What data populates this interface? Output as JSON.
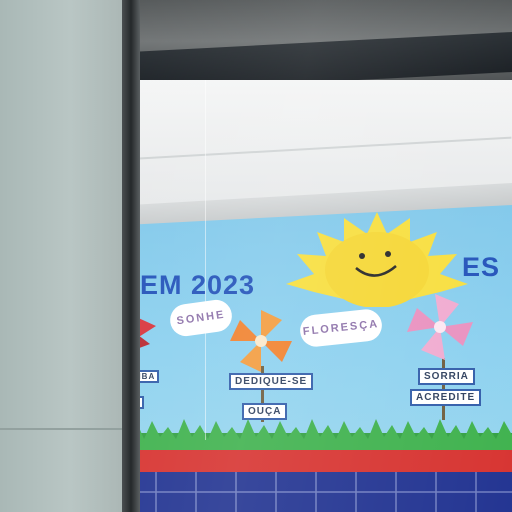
{
  "board": {
    "title_left": "EM 2023",
    "title_right": "ES",
    "clouds": {
      "sonhe": "SONHE",
      "floresca": "FLORESÇA"
    },
    "tags": {
      "dedique": "DEDIQUE-SE",
      "ouca": "OUÇA",
      "sorria": "SORRIA",
      "acredite": "ACREDITE",
      "frag1": "MBA",
      "frag2": "E"
    }
  },
  "colors": {
    "title": "#1e4fb8",
    "board_bg": "#8ad0ef",
    "sun": "#f7de3a",
    "red_band": "#d62f2c",
    "tiles": "#1d2f8f",
    "grass": "#2e9e3e"
  },
  "icons": [
    "sun-icon",
    "pinwheel-orange-icon",
    "pinwheel-pink-icon",
    "pinwheel-red-icon",
    "cloud-icon"
  ]
}
